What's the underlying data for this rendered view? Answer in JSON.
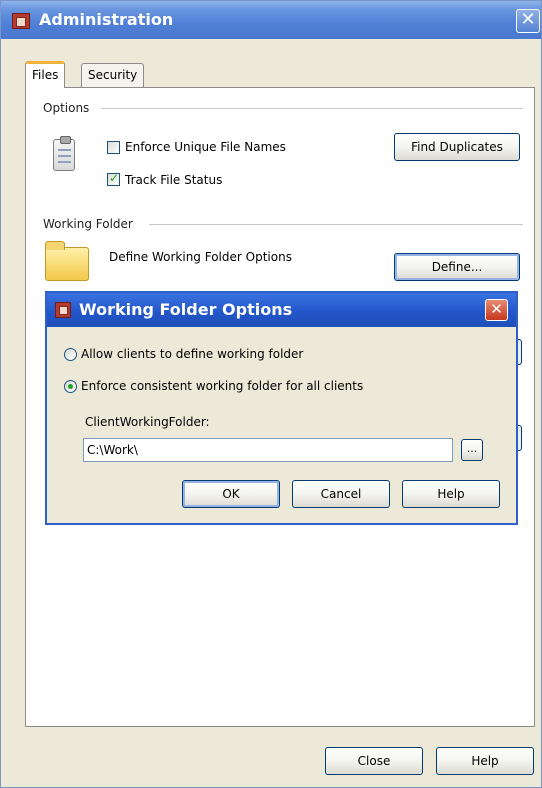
{
  "window": {
    "title": "Administration",
    "close_glyph": "✕",
    "tabs": [
      {
        "label": "Files",
        "active": true
      },
      {
        "label": "Security",
        "active": false
      }
    ]
  },
  "options": {
    "group_label": "Options",
    "enforce_unique_label": "Enforce Unique File Names",
    "enforce_unique_checked": false,
    "track_status_label": "Track File Status",
    "track_status_checked": true,
    "find_duplicates_label": "Find Duplicates"
  },
  "working_folder": {
    "group_label": "Working Folder",
    "description": "Define Working Folder Options",
    "define_label": "Define..."
  },
  "dialog": {
    "title": "Working Folder Options",
    "close_glyph": "✕",
    "radio_allow_label": "Allow clients to define working folder",
    "radio_enforce_label": "Enforce consistent working folder for all clients",
    "selected": "enforce",
    "field_label": "ClientWorkingFolder:",
    "field_value": "C:\\Work\\",
    "browse_label": "...",
    "ok_label": "OK",
    "cancel_label": "Cancel",
    "help_label": "Help"
  },
  "footer": {
    "close_label": "Close",
    "help_label": "Help"
  },
  "colors": {
    "titlebar": "#4f7fd6",
    "dialog_titlebar": "#2255c8",
    "dialog_close": "#c7381d",
    "tab_highlight": "#f0b33c",
    "check_green": "#21a121"
  }
}
